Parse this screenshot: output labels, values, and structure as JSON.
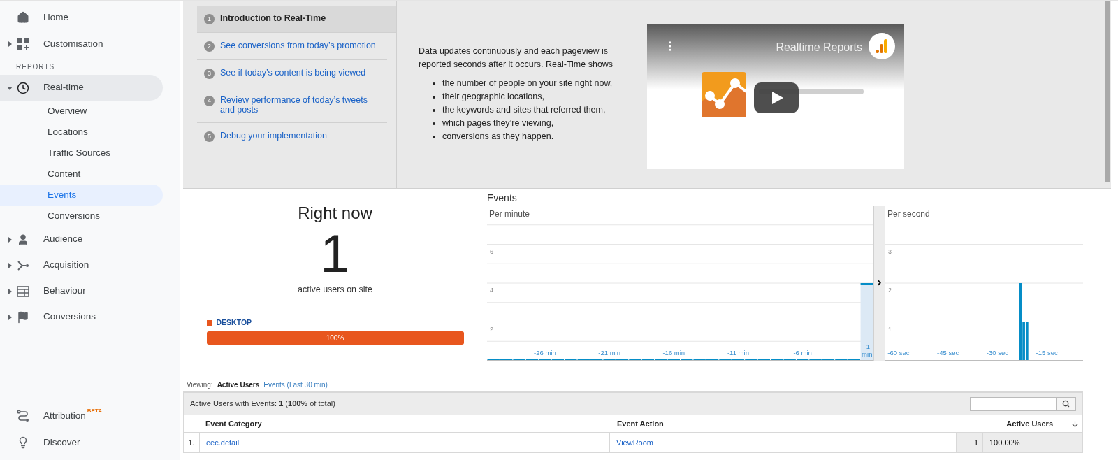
{
  "sidebar": {
    "top": [
      {
        "kind": "link",
        "label": "Home"
      },
      {
        "kind": "group",
        "label": "Customisation",
        "expanded": false
      }
    ],
    "reports": {
      "heading": "REPORTS",
      "groups": [
        {
          "label": "Real-time",
          "expanded": true,
          "selected": true,
          "children": [
            {
              "label": "Overview",
              "selected": false
            },
            {
              "label": "Locations",
              "selected": false
            },
            {
              "label": "Traffic Sources",
              "selected": false
            },
            {
              "label": "Content",
              "selected": false
            },
            {
              "label": "Events",
              "selected": true
            },
            {
              "label": "Conversions",
              "selected": false
            }
          ]
        },
        {
          "label": "Audience",
          "expanded": false,
          "selected": false
        },
        {
          "label": "Acquisition",
          "expanded": false,
          "selected": false
        },
        {
          "label": "Behaviour",
          "expanded": false,
          "selected": false
        },
        {
          "label": "Conversions",
          "expanded": false,
          "selected": false
        }
      ]
    },
    "bottom": [
      {
        "label": "Attribution",
        "badge": "BETA"
      },
      {
        "label": "Discover"
      }
    ]
  },
  "intro": {
    "steps": [
      {
        "number": "1",
        "label": "Introduction to Real-Time",
        "selected": true
      },
      {
        "number": "2",
        "label": "See conversions from today’s promotion",
        "selected": false
      },
      {
        "number": "3",
        "label": "See if today’s content is being viewed",
        "selected": false
      },
      {
        "number": "4",
        "label": "Review performance of today’s tweets and posts",
        "selected": false
      },
      {
        "number": "5",
        "label": "Debug your implementation",
        "selected": false
      }
    ],
    "description": "Data updates continuously and each pageview is reported seconds after it occurs. Real-Time shows",
    "bullets": [
      "the number of people on your site right now,",
      "their geographic locations,",
      "the keywords and sites that referred them,",
      "which pages they’re viewing,",
      "conversions as they happen."
    ],
    "video": {
      "title": "Realtime Reports"
    }
  },
  "right_now": {
    "heading": "Right now",
    "count": "1",
    "caption": "active users on site",
    "devices": [
      {
        "label": "DESKTOP",
        "color": "#e8561e",
        "level": 1,
        "reading": "100%"
      }
    ]
  },
  "events": {
    "title": "Events",
    "per_minute": {
      "label": "Per minute",
      "chart_data": {
        "type": "bar",
        "grid": true,
        "xlim": [
          -30.5,
          -0.5
        ],
        "x": [
          -30,
          -29,
          -28,
          -27,
          -26,
          -25,
          -24,
          -23,
          -22,
          -21,
          -20,
          -19,
          -18,
          -17,
          -16,
          -15,
          -14,
          -13,
          -12,
          -11,
          -10,
          -9,
          -8,
          -7,
          -6,
          -5,
          -4,
          -3,
          -2,
          -1
        ],
        "values": [
          0,
          0,
          0,
          0,
          0,
          0,
          0,
          0,
          0,
          0,
          0,
          0,
          0,
          0,
          0,
          0,
          0,
          0,
          0,
          0,
          0,
          0,
          0,
          0,
          0,
          0,
          0,
          0,
          0,
          4
        ],
        "ylim": [
          0,
          8
        ],
        "yticks": [
          2,
          4,
          6
        ],
        "xticks": [
          {
            "value": -26,
            "label": "-26 min"
          },
          {
            "value": -21,
            "label": "-21 min"
          },
          {
            "value": -16,
            "label": "-16 min"
          },
          {
            "value": -11,
            "label": "-11 min"
          },
          {
            "value": -6,
            "label": "-6 min"
          },
          {
            "value": -1,
            "label": "-1 min"
          }
        ]
      }
    },
    "per_second": {
      "label": "Per second",
      "chart_data": {
        "type": "bar",
        "grid": true,
        "xlim": [
          -64,
          -4
        ],
        "x": [
          -60,
          -59,
          -58,
          -57,
          -56,
          -55,
          -54,
          -53,
          -52,
          -51,
          -50,
          -49,
          -48,
          -47,
          -46,
          -45,
          -44,
          -43,
          -42,
          -41,
          -40,
          -39,
          -38,
          -37,
          -36,
          -35,
          -34,
          -33,
          -32,
          -31,
          -30,
          -29,
          -28,
          -27,
          -26,
          -25,
          -24,
          -23,
          -22,
          -21,
          -20,
          -19,
          -18,
          -17,
          -16,
          -15,
          -14,
          -13,
          -12,
          -11,
          -10,
          -9,
          -8,
          -7,
          -6,
          -5
        ],
        "values": [
          0,
          0,
          0,
          0,
          0,
          0,
          0,
          0,
          0,
          0,
          0,
          0,
          0,
          0,
          0,
          0,
          0,
          0,
          0,
          0,
          0,
          0,
          0,
          0,
          0,
          0,
          0,
          0,
          0,
          0,
          0,
          0,
          0,
          0,
          0,
          0,
          0,
          2,
          1,
          1,
          0,
          0,
          0,
          0,
          0,
          0,
          0,
          0,
          0,
          0,
          0,
          0,
          0,
          0,
          0,
          0
        ],
        "ylim": [
          0,
          4
        ],
        "yticks": [
          1,
          2,
          3
        ],
        "xticks": [
          {
            "value": -60,
            "label": "-60 sec"
          },
          {
            "value": -45,
            "label": "-45 sec"
          },
          {
            "value": -30,
            "label": "-30 sec"
          },
          {
            "value": -15,
            "label": "-15 sec"
          }
        ]
      }
    }
  },
  "viewing": {
    "label": "Viewing:",
    "tabs": [
      {
        "label": "Active Users",
        "selected": true
      },
      {
        "label": "Events (Last 30 min)",
        "selected": false
      }
    ]
  },
  "table": {
    "summary": "Active Users with Events: **1** (**100%** of total)",
    "columns": [
      "Event Category",
      "Event Action",
      "Active Users"
    ],
    "rows": [
      {
        "index": "1.",
        "category": "eec.detail",
        "action": "ViewRoom",
        "users": "1",
        "percent": "100.00%"
      }
    ]
  }
}
